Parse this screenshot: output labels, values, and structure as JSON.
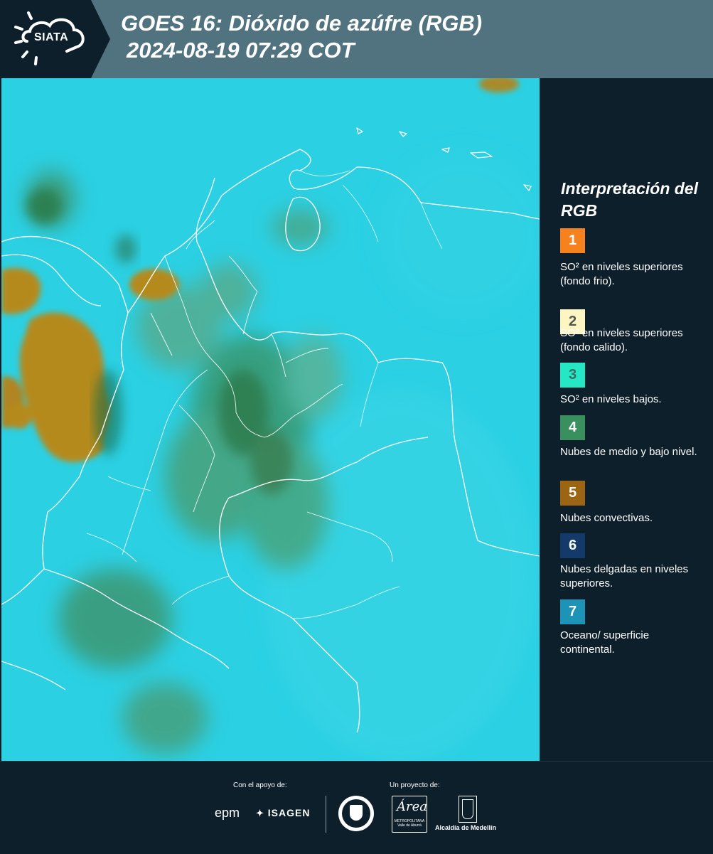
{
  "header": {
    "logo_text": "SIATA",
    "title_line1": "GOES 16: Dióxido de azúfre (RGB)",
    "title_line2": "2024-08-19 07:29 COT"
  },
  "legend": {
    "title": "Interpretación del RGB",
    "items": [
      {
        "num": "1",
        "color": "#f5821f",
        "text_color": "#ffffff",
        "text": "SO² en niveles superiores (fondo frio)."
      },
      {
        "num": "2",
        "color": "#fdf6c3",
        "text_color": "#555555",
        "text": "SO² en niveles superiores (fondo calido)."
      },
      {
        "num": "3",
        "color": "#27e6c3",
        "text_color": "#3a6b66",
        "text": "SO² en niveles bajos."
      },
      {
        "num": "4",
        "color": "#3a8f5f",
        "text_color": "#ffffff",
        "text": "Nubes de medio y bajo nivel."
      },
      {
        "num": "5",
        "color": "#9b6514",
        "text_color": "#ffffff",
        "text": "Nubes convectivas."
      },
      {
        "num": "6",
        "color": "#133a6b",
        "text_color": "#ffffff",
        "text": "Nubes delgadas en niveles superiores."
      },
      {
        "num": "7",
        "color": "#1e93b8",
        "text_color": "#ffffff",
        "text": "Oceano/ superficie continental."
      }
    ]
  },
  "footer": {
    "support_label": "Con el apoyo de:",
    "project_label": "Un proyecto de:",
    "sponsors": [
      "epm",
      "ISAGEN"
    ],
    "partners": [
      "Área Metropolitana Valle de Aburrá",
      "Alcaldía de Medellín"
    ],
    "partner_small": "METROPOLITANA Valle de Aburrá",
    "partner_script": "Área"
  }
}
